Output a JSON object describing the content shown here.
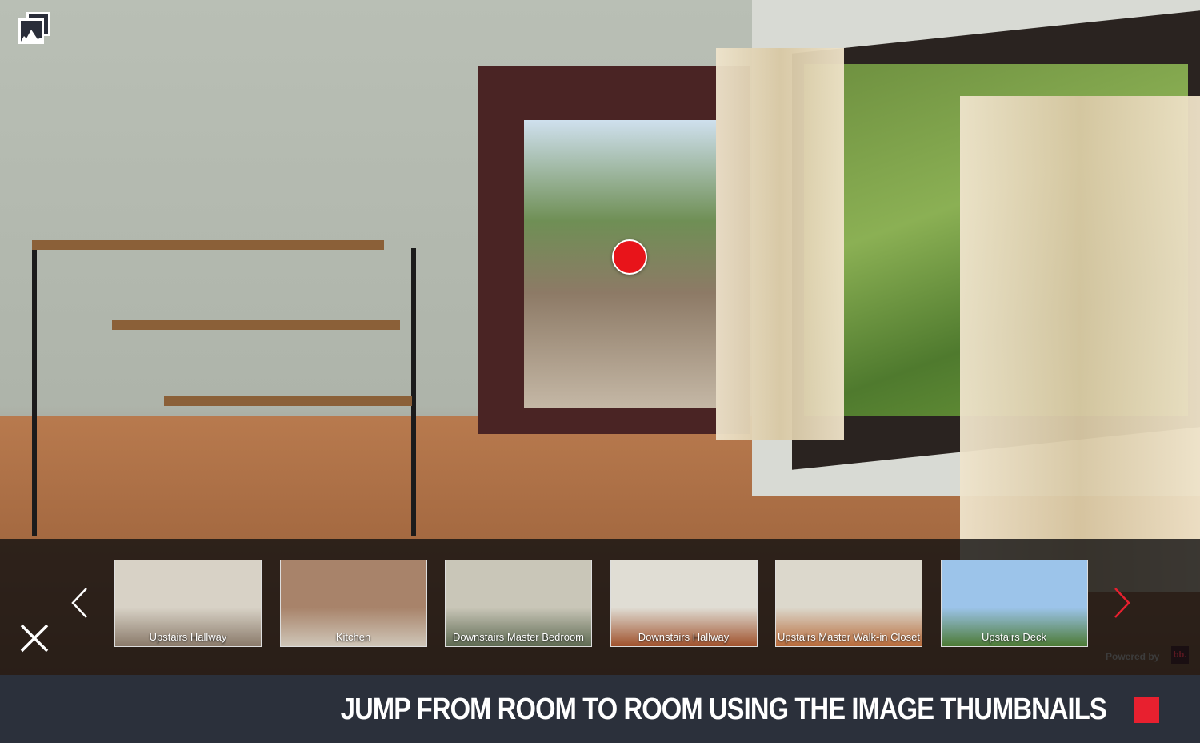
{
  "viewer": {
    "gallery_icon": "gallery-images-icon",
    "hotspot_color": "#e8141a"
  },
  "thumbnails": [
    {
      "label": "Upstairs Hallway",
      "colors": [
        "#d8d2c6",
        "#8a7a6a"
      ]
    },
    {
      "label": "Kitchen",
      "colors": [
        "#a8836a",
        "#cfc6b8"
      ]
    },
    {
      "label": "Downstairs Master Bedroom",
      "colors": [
        "#c9c6b8",
        "#5e6a52"
      ]
    },
    {
      "label": "Downstairs Hallway",
      "colors": [
        "#e0ddd4",
        "#a0522d"
      ]
    },
    {
      "label": "Upstairs Master Walk-in Closet",
      "colors": [
        "#dcd8cc",
        "#b76a3a"
      ]
    },
    {
      "label": "Upstairs Deck",
      "colors": [
        "#9cc4ea",
        "#4c7a34"
      ]
    }
  ],
  "controls": {
    "close_icon": "close-icon",
    "prev_icon": "chevron-left-icon",
    "next_icon": "chevron-right-icon"
  },
  "branding": {
    "powered_by": "Powered by",
    "logo": "bb."
  },
  "banner": {
    "title": "JUMP FROM ROOM TO ROOM USING THE IMAGE THUMBNAILS",
    "accent": "#e8202f"
  }
}
